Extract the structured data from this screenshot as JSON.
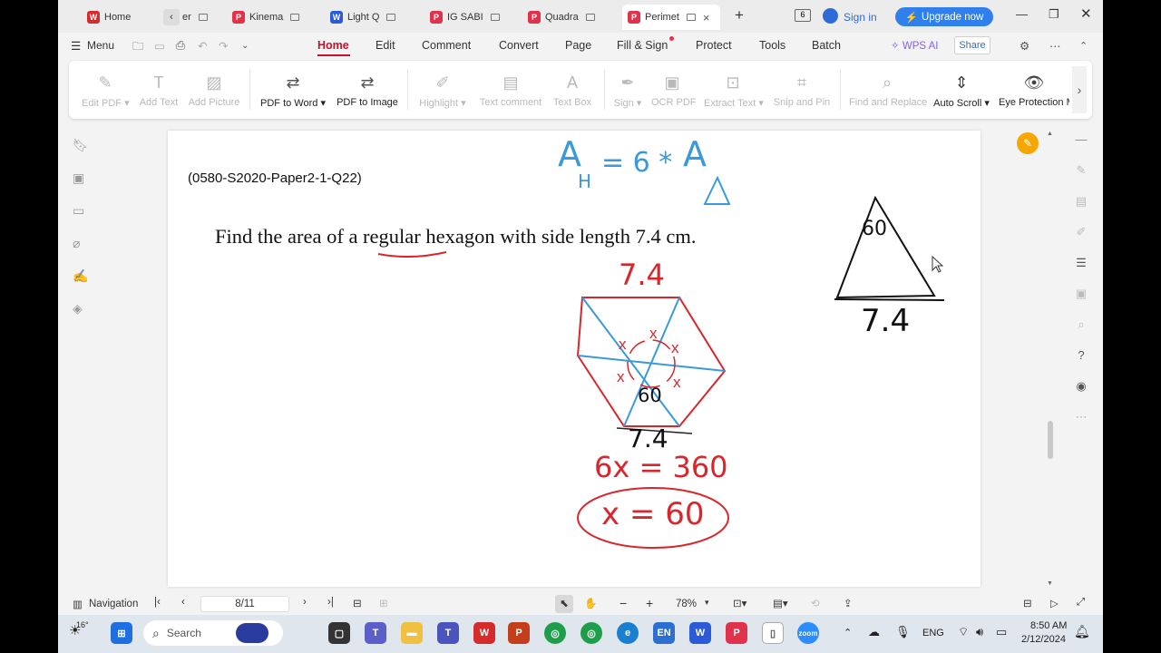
{
  "tabs": [
    {
      "label": "Home",
      "icon": "wps-logo-icon",
      "color": "#d62b2b"
    },
    {
      "label": "er",
      "icon": "chevron-left-icon",
      "color": "#888"
    },
    {
      "label": "Kinema",
      "icon": "pdf-icon",
      "color": "#e0324b"
    },
    {
      "label": "Light Q",
      "icon": "word-icon",
      "color": "#2b5bd7"
    },
    {
      "label": "IG SABI",
      "icon": "pdf-icon",
      "color": "#e0324b"
    },
    {
      "label": "Quadra",
      "icon": "pdf-icon",
      "color": "#e0324b"
    },
    {
      "label": "Perimet",
      "icon": "pdf-icon",
      "color": "#e0324b"
    }
  ],
  "header": {
    "notification_count": "6",
    "sign_in": "Sign in",
    "upgrade": "Upgrade now"
  },
  "menubar": {
    "menu_label": "Menu",
    "items": [
      "Home",
      "Edit",
      "Comment",
      "Convert",
      "Page",
      "Fill & Sign",
      "Protect",
      "Tools",
      "Batch"
    ],
    "active": "Home",
    "wps_ai": "WPS AI",
    "share": "Share"
  },
  "toolbar": {
    "tools": [
      {
        "label": "Edit PDF",
        "icon": "edit-pdf-icon",
        "enabled": false
      },
      {
        "label": "Add Text",
        "icon": "add-text-icon",
        "enabled": false
      },
      {
        "label": "Add Picture",
        "icon": "add-picture-icon",
        "enabled": false
      },
      {
        "label": "PDF to Word",
        "icon": "pdf-to-word-icon",
        "enabled": true
      },
      {
        "label": "PDF to Image",
        "icon": "pdf-to-image-icon",
        "enabled": true
      },
      {
        "label": "Highlight",
        "icon": "highlight-icon",
        "enabled": false
      },
      {
        "label": "Text comment",
        "icon": "text-comment-icon",
        "enabled": false
      },
      {
        "label": "Text Box",
        "icon": "text-box-icon",
        "enabled": false
      },
      {
        "label": "Sign",
        "icon": "sign-icon",
        "enabled": false
      },
      {
        "label": "OCR PDF",
        "icon": "ocr-icon",
        "enabled": false
      },
      {
        "label": "Extract Text",
        "icon": "extract-text-icon",
        "enabled": false
      },
      {
        "label": "Snip and Pin",
        "icon": "snip-icon",
        "enabled": false
      },
      {
        "label": "Find and Replace",
        "icon": "search-icon",
        "enabled": false
      },
      {
        "label": "Auto Scroll",
        "icon": "auto-scroll-icon",
        "enabled": true
      },
      {
        "label": "Eye Protection M",
        "icon": "eye-icon",
        "enabled": true
      }
    ]
  },
  "document": {
    "question_ref": "(0580-S2020-Paper2-1-Q22)",
    "question_text": "Find the area of a regular hexagon with side length 7.4 cm.",
    "annotations": {
      "formula_a": "A",
      "formula_h": "H",
      "formula_eq": "= 6 *",
      "formula_a2": "A",
      "formula_tri": "Δ",
      "hex_side_top": "7.4",
      "hex_side_bottom": "7.4",
      "angle_60": "60",
      "x_marks": [
        "x",
        "x",
        "x",
        "x",
        "x",
        "x"
      ],
      "equation1": "6x = 360",
      "equation2": "x = 60",
      "tri_angle": "60",
      "tri_side": "7.4"
    }
  },
  "bottombar": {
    "navigation": "Navigation",
    "page_indicator": "8/11",
    "zoom": "78%"
  },
  "taskbar": {
    "weather": "16°",
    "search": "Search",
    "lang": "ENG",
    "time": "8:50 AM",
    "date": "2/12/2024"
  },
  "colors": {
    "accent": "#c8102e",
    "upgrade_blue": "#2f80ed",
    "ink_blue": "#3a9ad9",
    "ink_red": "#d9262c"
  }
}
